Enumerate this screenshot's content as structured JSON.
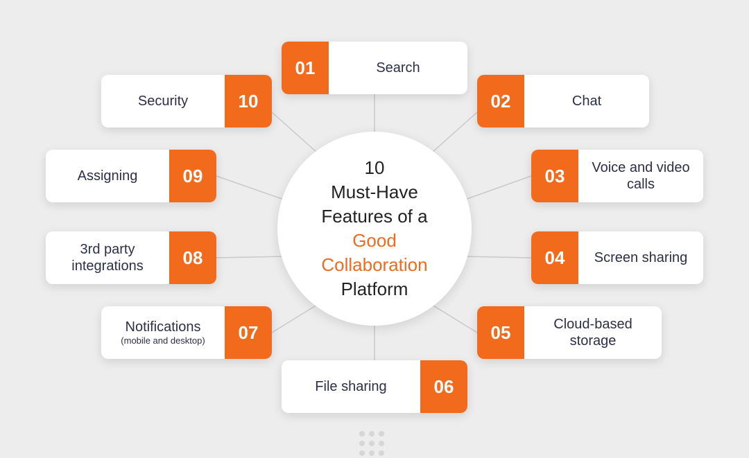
{
  "center": {
    "line1": "10",
    "line2": "Must-Have",
    "line3_pre": "Features of a ",
    "line3_accent": "Good",
    "line4_accent": "Collaboration",
    "line5": "Platform"
  },
  "items": [
    {
      "num": "01",
      "label": "Search"
    },
    {
      "num": "02",
      "label": "Chat"
    },
    {
      "num": "03",
      "label": "Voice and video calls"
    },
    {
      "num": "04",
      "label": "Screen sharing"
    },
    {
      "num": "05",
      "label": "Cloud-based storage"
    },
    {
      "num": "06",
      "label": "File sharing"
    },
    {
      "num": "07",
      "label": "Notifications",
      "sublabel": "(mobile and desktop)"
    },
    {
      "num": "08",
      "label": "3rd party integrations"
    },
    {
      "num": "09",
      "label": "Assigning"
    },
    {
      "num": "10",
      "label": "Security"
    }
  ],
  "colors": {
    "accent": "#f26a1b",
    "bg": "#ededed",
    "text": "#2a2f4a"
  }
}
